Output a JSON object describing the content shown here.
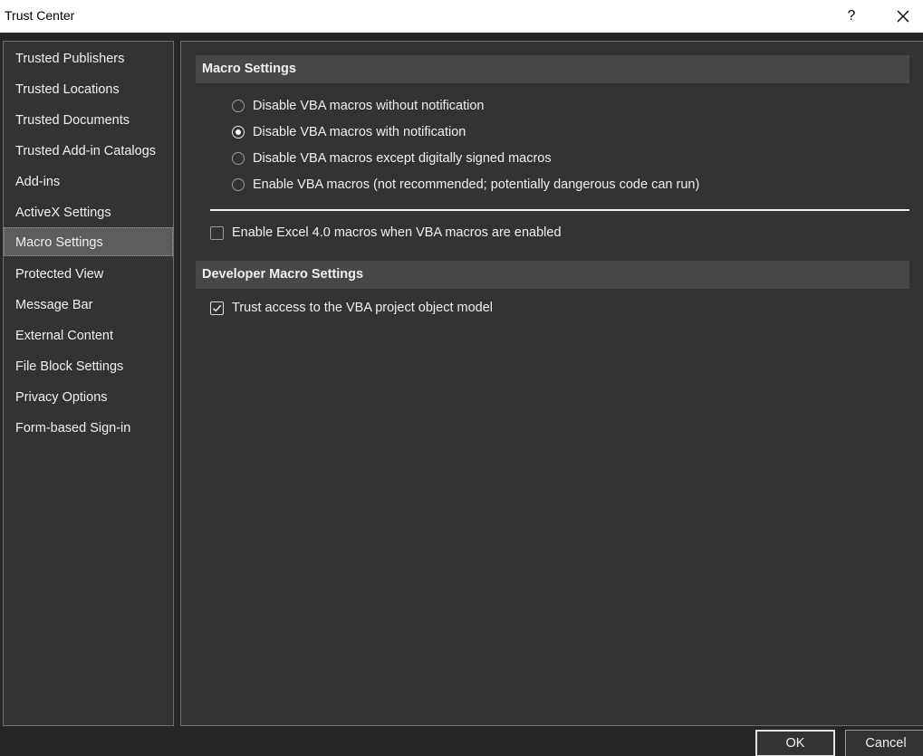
{
  "window": {
    "title": "Trust Center",
    "help_label": "?"
  },
  "sidebar": {
    "items": [
      {
        "label": "Trusted Publishers"
      },
      {
        "label": "Trusted Locations"
      },
      {
        "label": "Trusted Documents"
      },
      {
        "label": "Trusted Add-in Catalogs"
      },
      {
        "label": "Add-ins"
      },
      {
        "label": "ActiveX Settings"
      },
      {
        "label": "Macro Settings",
        "selected": true
      },
      {
        "label": "Protected View"
      },
      {
        "label": "Message Bar"
      },
      {
        "label": "External Content"
      },
      {
        "label": "File Block Settings"
      },
      {
        "label": "Privacy Options"
      },
      {
        "label": "Form-based Sign-in"
      }
    ]
  },
  "macro_settings": {
    "header": "Macro Settings",
    "options": [
      {
        "label": "Disable VBA macros without notification",
        "checked": false
      },
      {
        "label": "Disable VBA macros with notification",
        "checked": true
      },
      {
        "label": "Disable VBA macros except digitally signed macros",
        "checked": false
      },
      {
        "label": "Enable VBA macros (not recommended; potentially dangerous code can run)",
        "checked": false
      }
    ],
    "excel4_label": "Enable Excel 4.0 macros when VBA macros are enabled",
    "excel4_checked": false
  },
  "developer_settings": {
    "header": "Developer Macro Settings",
    "trust_vba_label": "Trust access to the VBA project object model",
    "trust_vba_checked": true
  },
  "buttons": {
    "ok": "OK",
    "cancel": "Cancel"
  },
  "colors": {
    "background": "#262626",
    "panel": "#333333",
    "header": "#474747",
    "selected": "#5d5d5d",
    "text": "#f0f0f0"
  },
  "icons": {
    "close": "close-icon",
    "checkmark": "checkmark-icon"
  }
}
